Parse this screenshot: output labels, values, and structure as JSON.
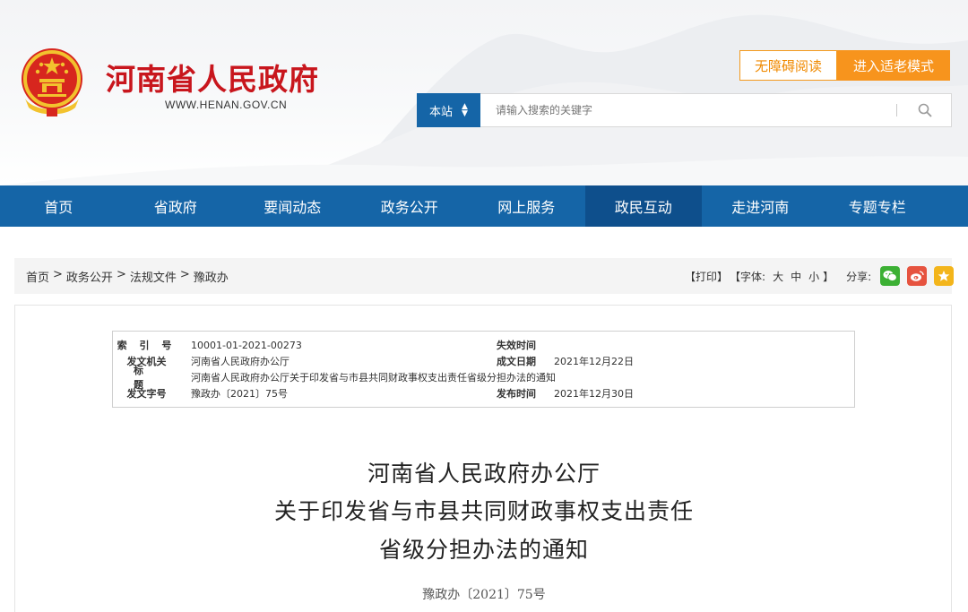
{
  "header": {
    "site_title": "河南省人民政府",
    "site_url": "WWW.HENAN.GOV.CN",
    "accessibility_label": "无障碍阅读",
    "elder_mode_label": "进入适老模式",
    "search": {
      "scope_label": "本站",
      "placeholder": "请输入搜索的关键字"
    }
  },
  "nav": {
    "items": [
      "首页",
      "省政府",
      "要闻动态",
      "政务公开",
      "网上服务",
      "政民互动",
      "走进河南",
      "专题专栏"
    ],
    "active_index": 5
  },
  "breadcrumb": {
    "items": [
      "首页",
      "政务公开",
      "法规文件",
      "豫政办"
    ],
    "separator": ">"
  },
  "tools": {
    "print_label": "【打印】",
    "font_label": "【字体:",
    "font_large": "大",
    "font_medium": "中",
    "font_small": "小",
    "font_close": "】",
    "share_label": "分享:",
    "share_icons": [
      "wechat-icon",
      "weibo-icon",
      "favorite-icon"
    ]
  },
  "meta": {
    "index_no_label": "索 引 号",
    "index_no": "10001-01-2021-00273",
    "expire_label": "失效时间",
    "expire": "",
    "issuer_label": "发文机关",
    "issuer": "河南省人民政府办公厅",
    "written_label": "成文日期",
    "written": "2021年12月22日",
    "title_label": "标 题",
    "title": "河南省人民政府办公厅关于印发省与市县共同财政事权支出责任省级分担办法的通知",
    "doc_no_label": "发文字号",
    "doc_no": "豫政办〔2021〕75号",
    "publish_label": "发布时间",
    "publish": "2021年12月30日"
  },
  "document": {
    "title_line1": "河南省人民政府办公厅",
    "title_line2": "关于印发省与市县共同财政事权支出责任",
    "title_line3": "省级分担办法的通知",
    "doc_number": "豫政办〔2021〕75号"
  },
  "colors": {
    "brand_red": "#c8161d",
    "nav_blue": "#1565a7",
    "nav_active": "#0e4f8c",
    "orange": "#f7941d"
  }
}
